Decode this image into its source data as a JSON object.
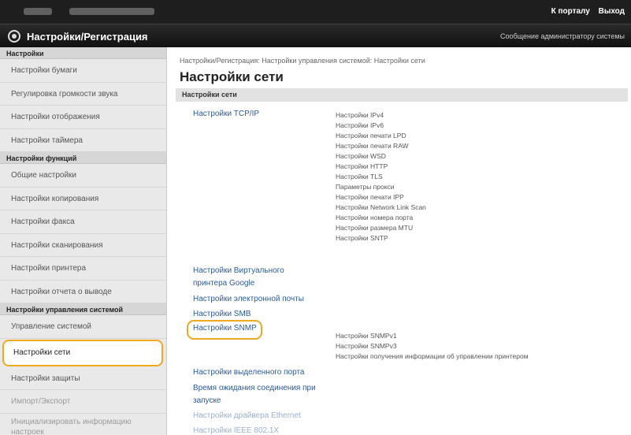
{
  "topbar": {
    "portal_link": "К порталу",
    "logout_link": "Выход"
  },
  "titlebar": {
    "title": "Настройки/Регистрация",
    "admin_message": "Сообщение администратору системы"
  },
  "sidebar": {
    "sections": [
      {
        "heading": "Настройки",
        "items": [
          "Настройки бумаги",
          "Регулировка громкости звука",
          "Настройки отображения",
          "Настройки таймера"
        ]
      },
      {
        "heading": "Настройки функций",
        "items": [
          "Общие настройки",
          "Настройки копирования",
          "Настройки факса",
          "Настройки сканирования",
          "Настройки принтера",
          "Настройки отчета о выводе"
        ]
      },
      {
        "heading": "Настройки управления системой",
        "items": [
          "Управление системой",
          "Настройки сети",
          "Настройки защиты",
          "Импорт/Экспорт",
          "Инициализировать информацию настроек"
        ]
      }
    ],
    "active_item": "Настройки сети"
  },
  "main": {
    "breadcrumb": "Настройки/Регистрация: Настройки управления системой: Настройки сети",
    "title": "Настройки сети",
    "section_heading": "Настройки сети",
    "tcpip_link": "Настройки TCP/IP",
    "tcpip_subs": [
      "Настройки IPv4",
      "Настройки IPv6",
      "Настройки печати LPD",
      "Настройки печати RAW",
      "Настройки WSD",
      "Настройки HTTP",
      "Настройки TLS",
      "Параметры прокси",
      "Настройки печати IPP",
      "Настройки Network Link Scan",
      "Настройки номера порта",
      "Настройки размера MTU",
      "Настройки SNTP"
    ],
    "google_link_line1": "Настройки Виртуального",
    "google_link_line2": "принтера Google",
    "email_link": "Настройки электронной почты",
    "sms_link": "Настройки SMB",
    "snmp_link": "Настройки SNMP",
    "snmp_subs": [
      "Настройки SNMPv1",
      "Настройки SNMPv3",
      "Настройки получения информации об управлении принтером"
    ],
    "dedicated_port_link": "Настройки выделенного порта",
    "wait_link_line1": "Время ожидания соединения при",
    "wait_link_line2": "запуске",
    "ethernet_link": "Настройки драйвера Ethernet",
    "ieee_link": "Настройки IEEE 802.1X"
  }
}
